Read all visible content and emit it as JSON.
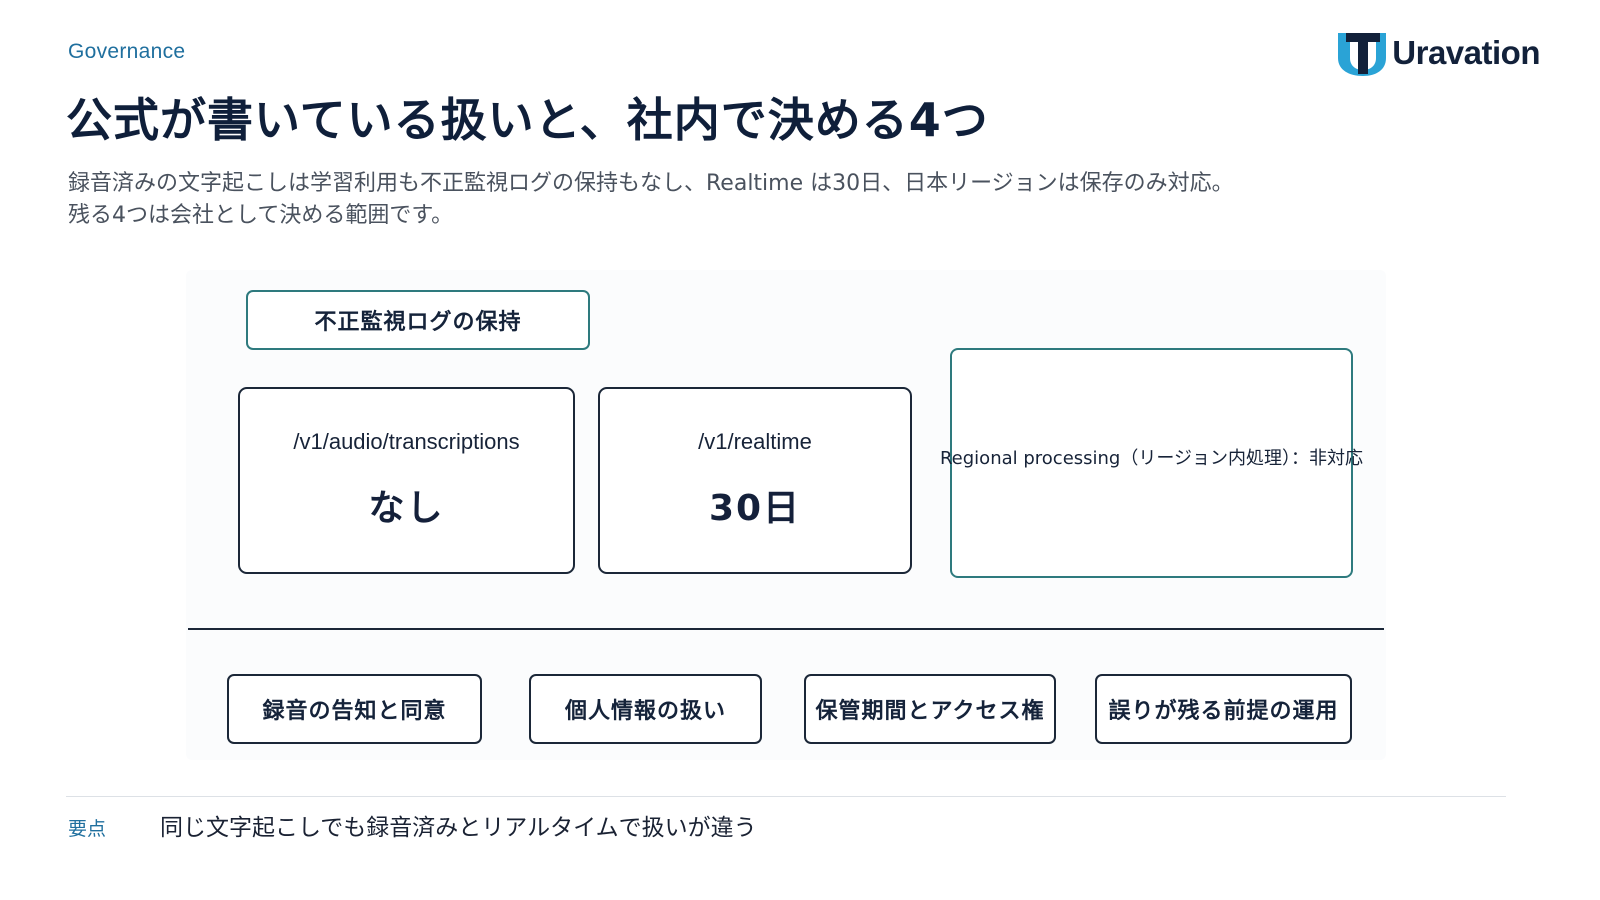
{
  "header": {
    "section_label": "Governance",
    "title": "公式が書いている扱いと、社内で決める4つ",
    "logo_text": "Uravation"
  },
  "subtitle": {
    "line1": "録音済みの文字起こしは学習利用も不正監視ログの保持もなし、Realtime は30日、日本リージョンは保存のみ対応。",
    "line2": "残る4つは会社として決める範囲です。"
  },
  "diagram": {
    "retention_label": "不正監視ログの保持",
    "endpoints": [
      {
        "path": "/v1/audio/transcriptions",
        "value": "なし"
      },
      {
        "path": "/v1/realtime",
        "value": "30日"
      }
    ],
    "region_card": "Regional processing（リージョン内処理）：非対応",
    "decisions": [
      "録音の告知と同意",
      "個人情報の扱い",
      "保管期間とアクセス権",
      "誤りが残る前提の運用"
    ]
  },
  "footer": {
    "key_label": "要点",
    "takeaway": "同じ文字起こしでも録音済みとリアルタイムで扱いが違う"
  },
  "colors": {
    "accent_teal": "#2e7a7e",
    "accent_blue": "#1f6f9e",
    "navy": "#1b2738",
    "logo_blue": "#2aa3d6"
  },
  "icons": {
    "logo_mark": "uravation-logo-icon"
  }
}
